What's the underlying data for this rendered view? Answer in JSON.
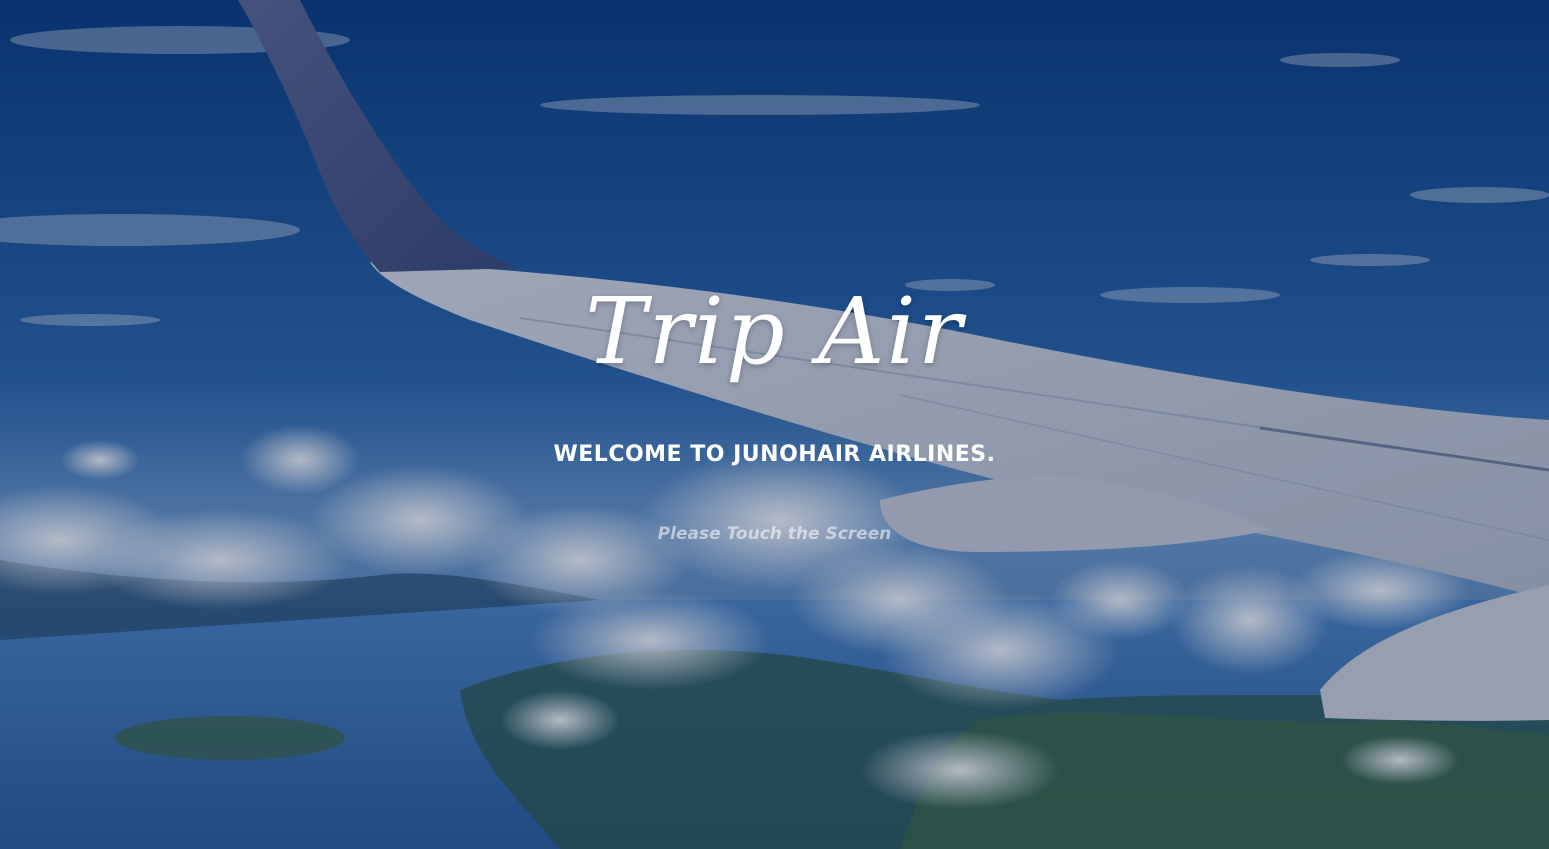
{
  "app": {
    "logo_text": "Trip Air",
    "welcome_text": "WELCOME TO JUNOHAIR AIRLINES.",
    "touch_hint": "Please Touch the Screen"
  },
  "background": {
    "description_icon": "airplane-wing-sky-photo",
    "sky_color_top": "#0a3f82",
    "sky_color_bottom": "#6f9ccd",
    "overlay_color": "#08143c"
  }
}
